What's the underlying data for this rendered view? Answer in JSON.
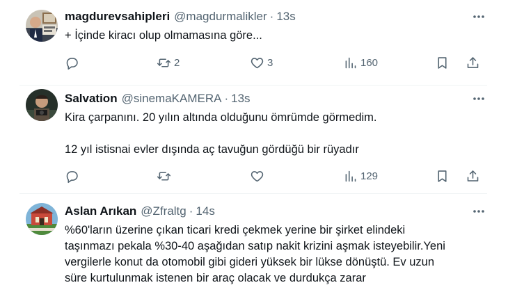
{
  "tweets": [
    {
      "display_name": "magdurevsahipleri",
      "handle": "@magdurmalikler",
      "time": "13s",
      "text_lines": [
        "+ İçinde kiracı olup olmamasına göre..."
      ],
      "retweets": "2",
      "likes": "3",
      "views": "160"
    },
    {
      "display_name": "Salvation",
      "handle": "@sinemaKAMERA",
      "time": "13s",
      "text_lines": [
        "Kira çarpanını. 20 yılın altında olduğunu ömrümde görmedim.",
        "",
        "12 yıl istisnai evler dışında aç tavuğun gördüğü bir rüyadır"
      ],
      "retweets": "",
      "likes": "",
      "views": "129"
    },
    {
      "display_name": "Aslan Arıkan",
      "handle": "@Zfraltg",
      "time": "14s",
      "text_lines": [
        "%60'ların üzerine çıkan ticari kredi çekmek yerine bir şirket elindeki",
        "taşınmazı pekala %30-40 aşağıdan satıp nakit krizini aşmak isteyebilir.Yeni",
        "vergilerle konut da otomobil gibi gideri yüksek bir lükse dönüştü. Ev uzun",
        "süre kurtulunmak istenen bir araç olacak ve durdukça zarar"
      ]
    }
  ],
  "separator": "·",
  "icons": {
    "more": "more-dots-icon",
    "reply": "reply-icon",
    "retweet": "retweet-icon",
    "like": "heart-icon",
    "views": "views-chart-icon",
    "bookmark": "bookmark-icon",
    "share": "share-icon"
  },
  "colors": {
    "text": "#0f1419",
    "secondary": "#536471",
    "divider": "#eff3f4"
  }
}
